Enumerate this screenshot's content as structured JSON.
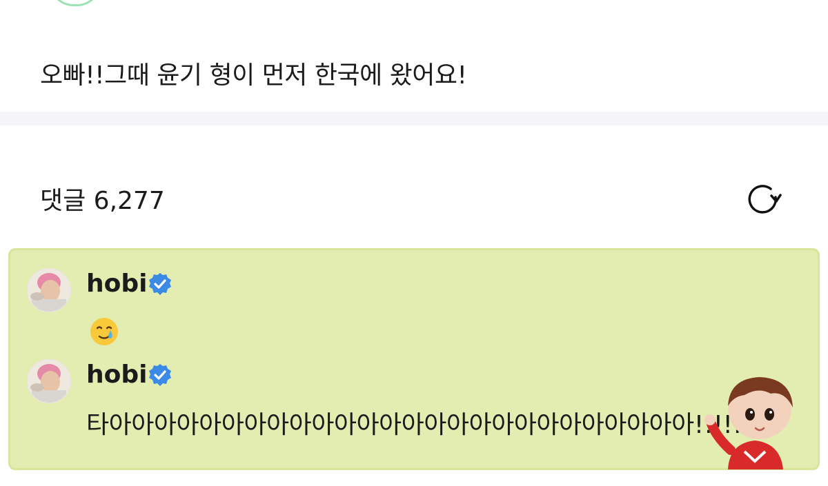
{
  "post": {
    "text": "오빠!!그때 윤기 형이 먼저 한국에 왔어요!"
  },
  "comments_section": {
    "title": "댓글 6,277",
    "refresh_icon": "refresh-icon"
  },
  "comments": [
    {
      "username": "hobi",
      "verified": true,
      "content_type": "emoji",
      "emoji": "smiling-face-with-tear"
    },
    {
      "username": "hobi",
      "verified": true,
      "content_type": "text",
      "text": "타아아아아아아아아아아아아아아아아아아아아아아아아아아!!!!!!"
    }
  ],
  "colors": {
    "highlight_background": "#e3ecb1",
    "highlight_border": "#d7e69a",
    "verified_badge": "#3b8be6",
    "divider": "#f5f5f9"
  },
  "sticker": {
    "icon": "character-sticker"
  }
}
